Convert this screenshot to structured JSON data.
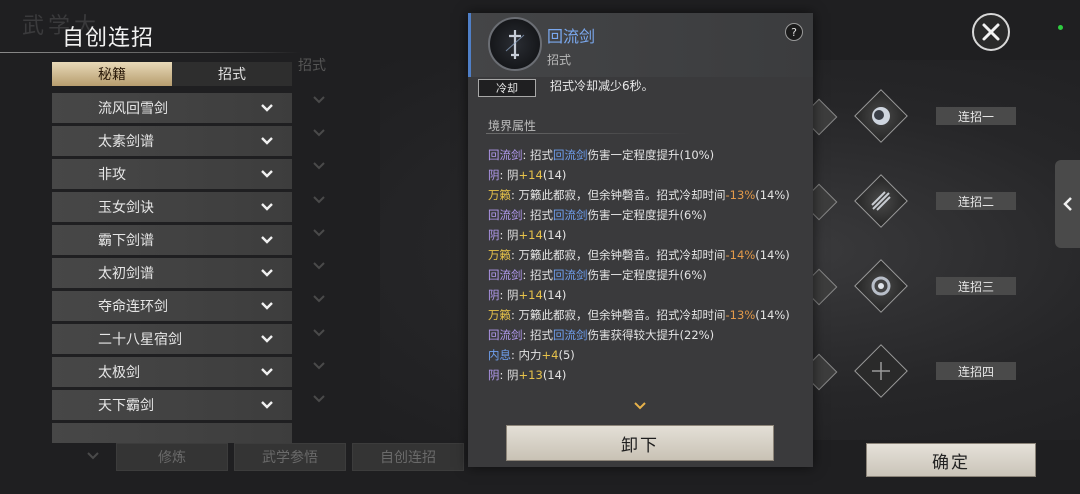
{
  "window": {
    "bg_title": "武学大",
    "title": "自创连招",
    "close_icon": "close-x-icon"
  },
  "tabs": {
    "active": "秘籍",
    "inactive": "招式",
    "ghost": "招式"
  },
  "list": {
    "items": [
      {
        "label": "流风回雪剑"
      },
      {
        "label": "太素剑谱"
      },
      {
        "label": "非攻"
      },
      {
        "label": "玉女剑诀"
      },
      {
        "label": "霸下剑谱"
      },
      {
        "label": "太初剑谱"
      },
      {
        "label": "夺命连环剑"
      },
      {
        "label": "二十八星宿剑"
      },
      {
        "label": "太极剑"
      },
      {
        "label": "天下霸剑"
      },
      {
        "label": ""
      }
    ]
  },
  "bottom_bar": {
    "buttons": [
      "修炼",
      "武学参悟",
      "自创连招"
    ],
    "confirm": "确定"
  },
  "combos": {
    "labels": [
      "连招一",
      "连招二",
      "连招三",
      "连招四"
    ],
    "slot4_icon": "plus-icon"
  },
  "popup": {
    "skill_name": "回流剑",
    "skill_type": "招式",
    "help_icon": "?",
    "cooldown_tag": "冷却",
    "cooldown_text": "招式冷却减少6秒。",
    "realm_title": "境界属性",
    "attributes": [
      {
        "src": "回流剑",
        "prefix": "招式",
        "skill": "回流剑",
        "text": "伤害一定程度提升",
        "val": "(10%)"
      },
      {
        "src": "阴",
        "prefix": "阴",
        "plus": "+14",
        "val": "(14)"
      },
      {
        "src": "万籁",
        "text": "万籁此都寂，但余钟磬音。招式冷却时间",
        "minus": "-13%",
        "val": "(14%)"
      },
      {
        "src": "回流剑",
        "prefix": "招式",
        "skill": "回流剑",
        "text": "伤害一定程度提升",
        "val": "(6%)"
      },
      {
        "src": "阴",
        "prefix": "阴",
        "plus": "+14",
        "val": "(14)"
      },
      {
        "src": "万籁",
        "text": "万籁此都寂，但余钟磬音。招式冷却时间",
        "minus": "-14%",
        "val": "(14%)"
      },
      {
        "src": "回流剑",
        "prefix": "招式",
        "skill": "回流剑",
        "text": "伤害一定程度提升",
        "val": "(6%)"
      },
      {
        "src": "阴",
        "prefix": "阴",
        "plus": "+14",
        "val": "(14)"
      },
      {
        "src": "万籁",
        "text": "万籁此都寂，但余钟磬音。招式冷却时间",
        "minus": "-13%",
        "val": "(14%)"
      },
      {
        "src": "回流剑",
        "prefix": "招式",
        "skill": "回流剑",
        "text": "伤害获得较大提升",
        "val": "(22%)"
      },
      {
        "src": "内息",
        "prefix": "内力",
        "plus": "+4",
        "val": "(5)"
      },
      {
        "src": "阴",
        "prefix": "阴",
        "plus": "+13",
        "val": "(14)"
      }
    ],
    "unload_button": "卸下"
  },
  "colors": {
    "accent_blue": "#7aa8ee",
    "purple": "#b39af0",
    "gold": "#e7c24a"
  }
}
